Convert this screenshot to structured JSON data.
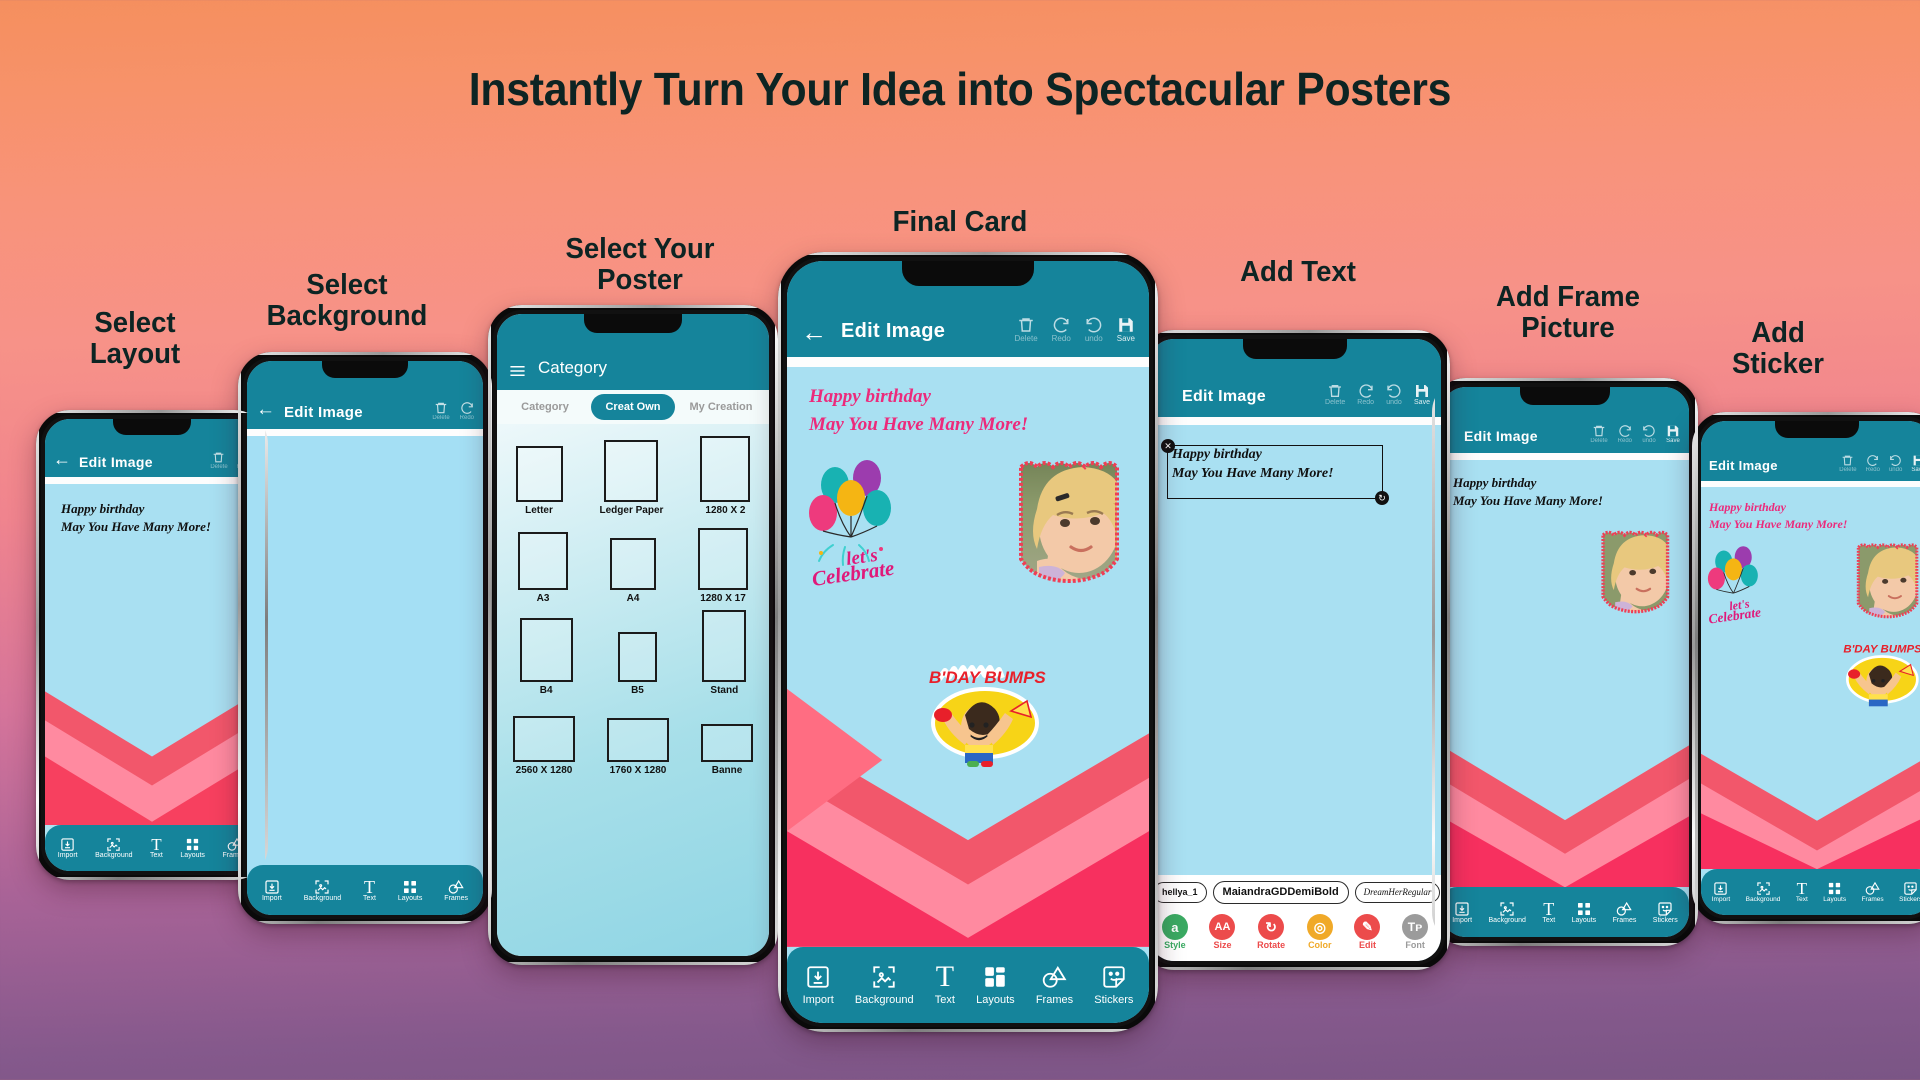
{
  "headline": "Instantly Turn Your Idea into Spectacular Posters",
  "colors": {
    "teal": "#15849b",
    "pink": "#ec2a7b",
    "card_bg": "#a9e0f2",
    "bg_top": "#f58f5e",
    "bg_bottom": "#7a5585"
  },
  "card": {
    "line1": "Happy birthday",
    "line2": "May You Have Many More!",
    "sticker_celebrate": "let's Celebrate",
    "sticker_bday": "B'DAY BUMPS"
  },
  "header": {
    "title": "Edit Image",
    "back_icon": "back-arrow-icon",
    "actions": [
      {
        "label": "Delete",
        "icon": "trash-icon"
      },
      {
        "label": "Redo",
        "icon": "redo-icon"
      },
      {
        "label": "undo",
        "icon": "undo-icon"
      },
      {
        "label": "Save",
        "icon": "save-icon"
      }
    ]
  },
  "toolbar": {
    "items": [
      {
        "label": "Import",
        "icon": "import-icon"
      },
      {
        "label": "Background",
        "icon": "background-image-icon"
      },
      {
        "label": "Text",
        "icon": "text-t-icon"
      },
      {
        "label": "Layouts",
        "icon": "layouts-grid-icon"
      },
      {
        "label": "Frames",
        "icon": "frames-shapes-icon"
      },
      {
        "label": "Stickers",
        "icon": "sticker-smiley-icon"
      }
    ]
  },
  "category_screen": {
    "title": "Category",
    "menu_icon": "hamburger-menu-icon",
    "tabs": [
      {
        "label": "Category",
        "active": false
      },
      {
        "label": "Creat Own",
        "active": true
      },
      {
        "label": "My Creation",
        "active": false
      }
    ],
    "sizes": [
      [
        "Letter",
        "Ledger Paper",
        "1280 X 2"
      ],
      [
        "A3",
        "A4",
        "1280 X 17"
      ],
      [
        "B4",
        "B5",
        "Stand"
      ],
      [
        "2560 X 1280",
        "1760 X 1280",
        "Banne"
      ]
    ]
  },
  "add_text_screen": {
    "fonts": [
      "hellya_1",
      "MaiandraGDDemiBold",
      "DreamHerRegular",
      "a"
    ],
    "actions": [
      {
        "label": "Style",
        "color": "#3aaa62",
        "glyph": "a"
      },
      {
        "label": "Size",
        "color": "#ec4b4b",
        "glyph": "AA"
      },
      {
        "label": "Rotate",
        "color": "#ec4b4b",
        "glyph": "↺"
      },
      {
        "label": "Color",
        "color": "#f0a928",
        "glyph": "◎"
      },
      {
        "label": "Edit",
        "color": "#ec4b4b",
        "glyph": "✎"
      },
      {
        "label": "Font",
        "color": "#9b9b9b",
        "glyph": "Tᴛ"
      }
    ]
  },
  "phones": [
    {
      "id": "select-layout",
      "label": "Select\nLayout"
    },
    {
      "id": "select-background",
      "label": "Select\nBackground"
    },
    {
      "id": "select-your-poster",
      "label": "Select Your\nPoster"
    },
    {
      "id": "final-card",
      "label": "Final Card"
    },
    {
      "id": "add-text",
      "label": "Add Text"
    },
    {
      "id": "add-frame-picture",
      "label": "Add Frame\nPicture"
    },
    {
      "id": "add-sticker",
      "label": "Add\nSticker"
    }
  ]
}
